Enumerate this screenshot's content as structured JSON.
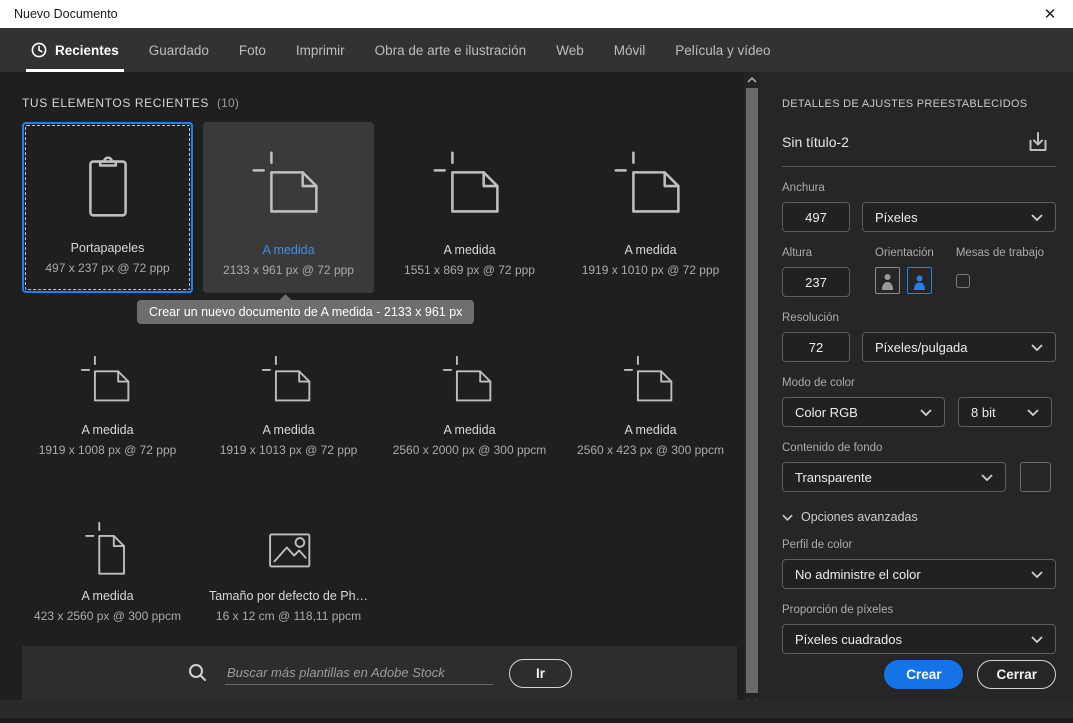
{
  "window": {
    "title": "Nuevo Documento",
    "close_glyph": "✕"
  },
  "tabs": [
    {
      "label": "Recientes",
      "active": true
    },
    {
      "label": "Guardado",
      "active": false
    },
    {
      "label": "Foto",
      "active": false
    },
    {
      "label": "Imprimir",
      "active": false
    },
    {
      "label": "Obra de arte e ilustración",
      "active": false
    },
    {
      "label": "Web",
      "active": false
    },
    {
      "label": "Móvil",
      "active": false
    },
    {
      "label": "Película y vídeo",
      "active": false
    }
  ],
  "recents": {
    "heading": "TUS ELEMENTOS RECIENTES",
    "count": "(10)",
    "items": [
      {
        "name": "Portapapeles",
        "dims": "497 x 237 px @ 72 ppp",
        "icon": "clipboard",
        "state": "selected"
      },
      {
        "name": "A medida",
        "dims": "2133 x 961 px @ 72 ppp",
        "icon": "doc-landscape",
        "state": "hover"
      },
      {
        "name": "A medida",
        "dims": "1551 x 869 px @ 72 ppp",
        "icon": "doc-landscape",
        "state": "normal"
      },
      {
        "name": "A medida",
        "dims": "1919 x 1010 px @ 72 ppp",
        "icon": "doc-landscape",
        "state": "normal"
      },
      {
        "name": "A medida",
        "dims": "1919 x 1008 px @ 72 ppp",
        "icon": "doc-landscape",
        "state": "normal"
      },
      {
        "name": "A medida",
        "dims": "1919 x 1013 px @ 72 ppp",
        "icon": "doc-landscape",
        "state": "normal"
      },
      {
        "name": "A medida",
        "dims": "2560 x 2000 px @ 300 ppcm",
        "icon": "doc-landscape",
        "state": "normal"
      },
      {
        "name": "A medida",
        "dims": "2560 x 423 px @ 300 ppcm",
        "icon": "doc-landscape",
        "state": "normal"
      },
      {
        "name": "A medida",
        "dims": "423 x 2560 px @ 300 ppcm",
        "icon": "doc-portrait",
        "state": "normal"
      },
      {
        "name": "Tamaño por defecto de Ph…",
        "dims": "16 x 12 cm @ 118,11 ppcm",
        "icon": "photo",
        "state": "normal"
      }
    ]
  },
  "tooltip": {
    "text": "Crear un nuevo documento de A medida - 2133 x 961 px"
  },
  "search": {
    "placeholder": "Buscar más plantillas en Adobe Stock",
    "go_label": "Ir"
  },
  "details": {
    "heading": "DETALLES DE AJUSTES PREESTABLECIDOS",
    "doc_title": "Sin título-2",
    "width": {
      "label": "Anchura",
      "value": "497",
      "unit": "Píxeles"
    },
    "height": {
      "label": "Altura",
      "value": "237"
    },
    "orientation": {
      "label": "Orientación",
      "selected": "landscape"
    },
    "artboards": {
      "label": "Mesas de trabajo",
      "checked": false
    },
    "resolution": {
      "label": "Resolución",
      "value": "72",
      "unit": "Píxeles/pulgada"
    },
    "color_mode": {
      "label": "Modo de color",
      "value": "Color RGB",
      "depth": "8 bit"
    },
    "background": {
      "label": "Contenido de fondo",
      "value": "Transparente"
    },
    "advanced": {
      "label": "Opciones avanzadas"
    },
    "color_profile": {
      "label": "Perfil de color",
      "value": "No administre el color"
    },
    "pixel_ratio": {
      "label": "Proporción de píxeles",
      "value": "Píxeles cuadrados"
    },
    "create_label": "Crear",
    "close_label": "Cerrar"
  },
  "colors": {
    "accent": "#1473e6",
    "selection_blue": "#2680eb",
    "hover_link_blue": "#3f8fe8"
  }
}
